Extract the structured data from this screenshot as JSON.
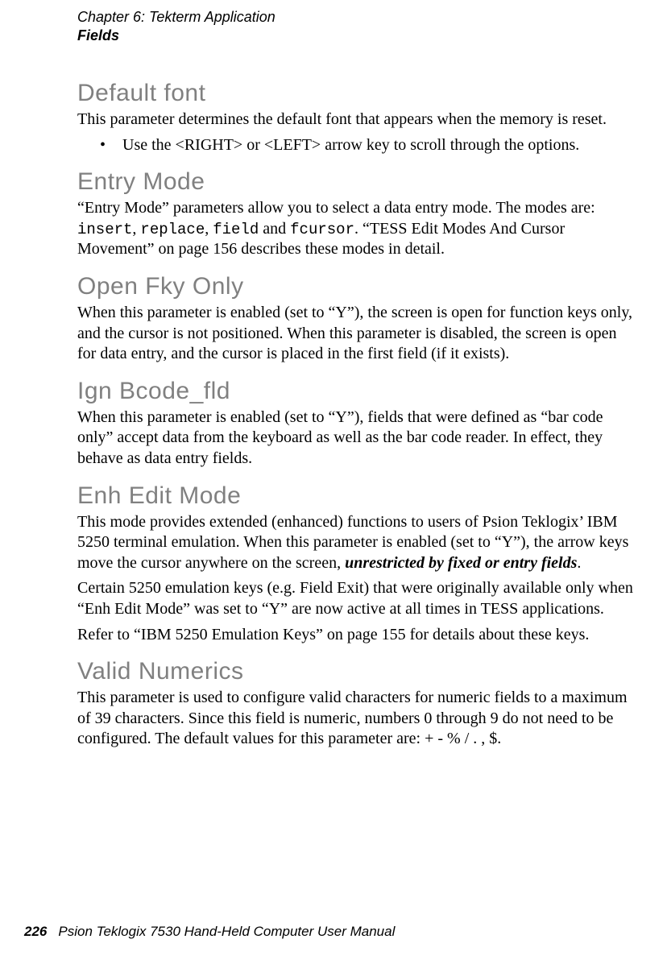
{
  "header": {
    "chapter": "Chapter  6:  Tekterm Application",
    "section": "Fields"
  },
  "sections": {
    "default_font": {
      "title": "Default font",
      "p1": "This parameter determines the default font that appears when the memory is reset.",
      "bullet1": "Use the <RIGHT> or <LEFT> arrow key to scroll through the options."
    },
    "entry_mode": {
      "title": "Entry Mode",
      "p1_pre": "“Entry Mode” parameters allow you to select a data entry mode. The modes are: ",
      "code_insert": "insert",
      "sep1": ", ",
      "code_replace": "replace",
      "sep2": ", ",
      "code_field": "field",
      "sep3": " and ",
      "code_fcursor": "fcursor",
      "p1_post": ". “TESS Edit Modes And Cursor Movement” on page 156 describes these modes in detail."
    },
    "open_fky": {
      "title": "Open Fky Only",
      "p1": "When this parameter is enabled (set to “Y”), the screen is open for function keys only, and the cursor is not positioned. When this parameter is disabled, the screen is open for data entry, and the cursor is placed in the first field (if it exists)."
    },
    "ign_bcode": {
      "title": "Ign Bcode_fld",
      "p1": "When this parameter is enabled (set to “Y”), fields that were defined as “bar code only” accept data from the keyboard as well as the bar code reader. In effect, they behave as data entry fields."
    },
    "enh_edit": {
      "title": "Enh Edit Mode",
      "p1_pre": "This mode provides extended (enhanced) functions to users of Psion Teklogix’ IBM 5250 terminal emulation. When this parameter is enabled (set to “Y”), the arrow keys move the cursor anywhere on the screen, ",
      "p1_em": "unrestricted by fixed or entry fields",
      "p1_post": ".",
      "p2": "Certain 5250 emulation keys (e.g. Field Exit) that were originally available only when “Enh Edit Mode” was set to “Y” are now active at all times in TESS applications.",
      "p3": "Refer to “IBM 5250 Emulation Keys” on page 155 for details about these keys."
    },
    "valid_numerics": {
      "title": "Valid Numerics",
      "p1": "This parameter is used to configure valid characters for numeric fields to a maximum of 39 characters. Since this field is numeric, numbers 0 through 9 do not need to be configured. The default values for this parameter are: + - % / . , $."
    }
  },
  "footer": {
    "page": "226",
    "text": "Psion Teklogix 7530 Hand-Held Computer User Manual"
  }
}
